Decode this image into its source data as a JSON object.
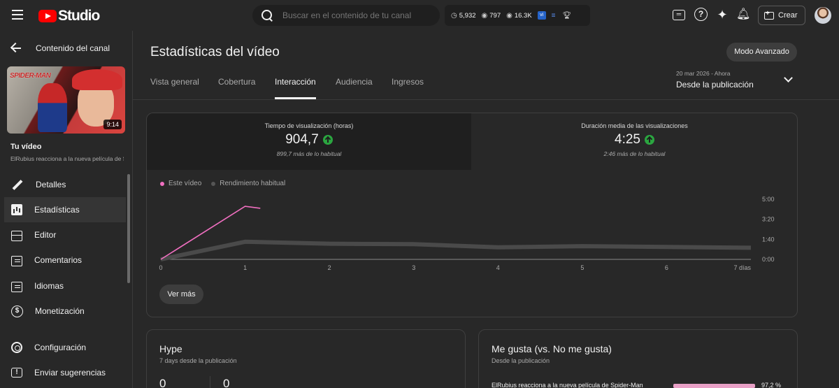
{
  "header": {
    "logo_text": "Studio",
    "search_placeholder": "Buscar en el contenido de tu canal",
    "stats": [
      {
        "icon": "clock-icon",
        "value": "5,932"
      },
      {
        "icon": "eye-icon",
        "value": "797"
      },
      {
        "icon": "eye-icon",
        "value": "16.3K"
      }
    ],
    "create_label": "Crear"
  },
  "sidebar": {
    "back_label": "Contenido del canal",
    "thumbnail": {
      "title_text": "SPIDER-MAN",
      "duration": "9:14"
    },
    "your_video_label": "Tu vídeo",
    "video_title": "ElRubius reacciona a la nueva película de Spider-Man",
    "items": [
      {
        "label": "Detalles",
        "icon": "pencil-icon"
      },
      {
        "label": "Estadísticas",
        "icon": "analytics-icon",
        "active": true
      },
      {
        "label": "Editor",
        "icon": "editor-icon"
      },
      {
        "label": "Comentarios",
        "icon": "comments-icon"
      },
      {
        "label": "Idiomas",
        "icon": "subtitles-icon"
      },
      {
        "label": "Monetización",
        "icon": "dollar-icon"
      }
    ],
    "bottom_items": [
      {
        "label": "Configuración",
        "icon": "gear-icon"
      },
      {
        "label": "Enviar sugerencias",
        "icon": "feedback-icon"
      }
    ]
  },
  "main": {
    "title": "Estadísticas del vídeo",
    "advanced_button": "Modo Avanzado",
    "tabs": [
      "Vista general",
      "Cobertura",
      "Interacción",
      "Audiencia",
      "Ingresos"
    ],
    "active_tab": "Interacción",
    "date_range": {
      "small": "20 mar 2026 - Ahora",
      "main": "Desde la publicación"
    },
    "metrics": [
      {
        "label": "Tiempo de visualización (horas)",
        "value": "904,7",
        "sub": "899,7 más de lo habitual",
        "trend": "up"
      },
      {
        "label": "Duración media de las visualizaciones",
        "value": "4:25",
        "sub": "2:46 más de lo habitual",
        "trend": "up"
      }
    ],
    "see_more": "Ver más",
    "hype": {
      "title": "Hype",
      "subtitle": "7 days desde la publicación",
      "values": [
        "0",
        "0"
      ]
    },
    "likes": {
      "title": "Me gusta (vs. No me gusta)",
      "subtitle": "Desde la publicación",
      "row_label": "ElRubius reacciona a la nueva película de Spider-Man",
      "row_percent": "97,2 %",
      "row_value": 97.2
    }
  },
  "chart_data": {
    "type": "line",
    "legend": [
      {
        "name": "Este vídeo",
        "color": "#f06fc0"
      },
      {
        "name": "Rendimiento habitual",
        "color": "#555555"
      }
    ],
    "x_ticks": [
      "0",
      "1",
      "2",
      "3",
      "4",
      "5",
      "6",
      "7 días"
    ],
    "y_ticks": [
      "0:00",
      "1:40",
      "3:20",
      "5:00"
    ],
    "xlim": [
      0,
      7
    ],
    "ylim": [
      0,
      300
    ],
    "series": [
      {
        "name": "Este vídeo",
        "x": [
          0,
          1,
          1.18
        ],
        "y": [
          0,
          265,
          255
        ]
      },
      {
        "name": "Rendimiento habitual",
        "x": [
          0,
          1,
          2,
          3,
          4,
          5,
          6,
          7
        ],
        "y": [
          0,
          88,
          78,
          76,
          60,
          66,
          62,
          58
        ]
      }
    ]
  }
}
